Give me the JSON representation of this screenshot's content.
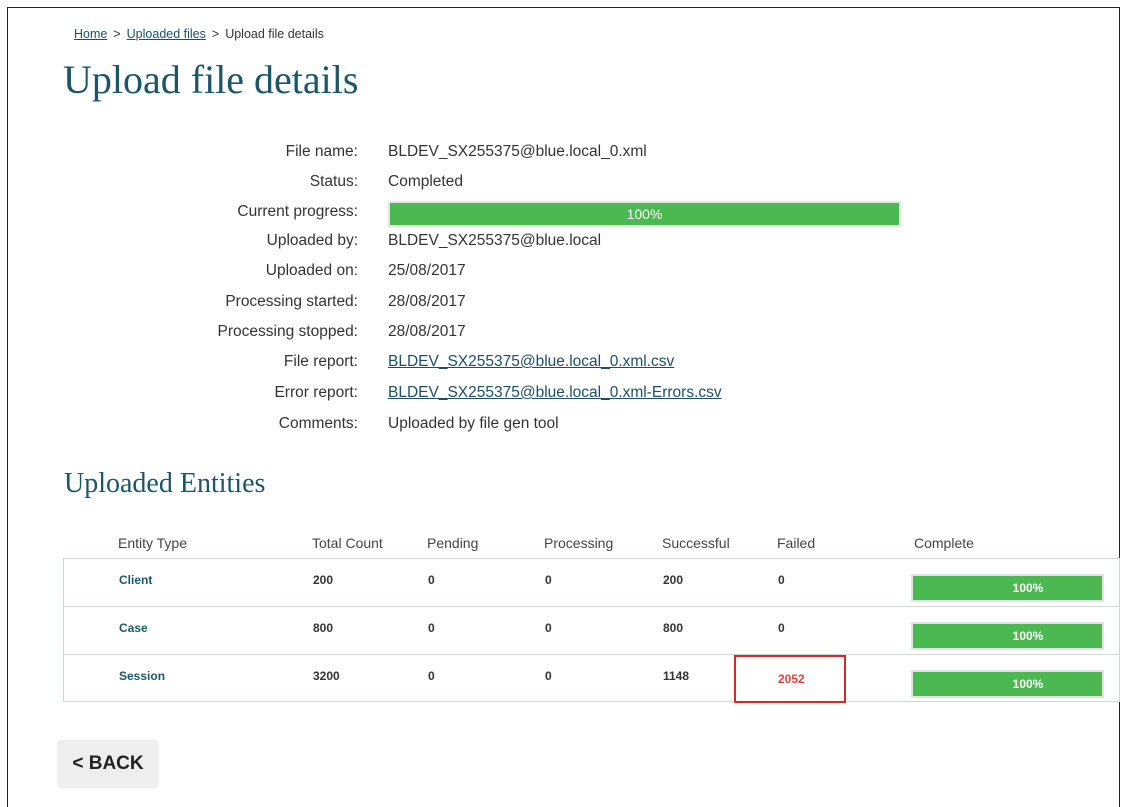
{
  "breadcrumb": {
    "home": "Home",
    "uploaded_files": "Uploaded files",
    "current": "Upload file details",
    "separator": ">"
  },
  "page_title": "Upload file details",
  "details": {
    "file_name": {
      "label": "File name:",
      "value": "BLDEV_SX255375@blue.local_0.xml"
    },
    "status": {
      "label": "Status:",
      "value": "Completed"
    },
    "current_progress": {
      "label": "Current progress:",
      "value": "100%",
      "percent": 100
    },
    "uploaded_by": {
      "label": "Uploaded by:",
      "value": "BLDEV_SX255375@blue.local"
    },
    "uploaded_on": {
      "label": "Uploaded on:",
      "value": "25/08/2017"
    },
    "processing_started": {
      "label": "Processing started:",
      "value": "28/08/2017"
    },
    "processing_stopped": {
      "label": "Processing stopped:",
      "value": "28/08/2017"
    },
    "file_report": {
      "label": "File report:",
      "value": "BLDEV_SX255375@blue.local_0.xml.csv"
    },
    "error_report": {
      "label": "Error report:",
      "value": "BLDEV_SX255375@blue.local_0.xml-Errors.csv"
    },
    "comments": {
      "label": "Comments:",
      "value": "Uploaded by file gen tool"
    }
  },
  "entities": {
    "title": "Uploaded Entities",
    "columns": [
      "Entity Type",
      "Total Count",
      "Pending",
      "Processing",
      "Successful",
      "Failed",
      "Complete"
    ],
    "rows": [
      {
        "type": "Client",
        "total": "200",
        "pending": "0",
        "processing": "0",
        "successful": "200",
        "failed": "0",
        "complete": "100%",
        "complete_percent": 100
      },
      {
        "type": "Case",
        "total": "800",
        "pending": "0",
        "processing": "0",
        "successful": "800",
        "failed": "0",
        "complete": "100%",
        "complete_percent": 100
      },
      {
        "type": "Session",
        "total": "3200",
        "pending": "0",
        "processing": "0",
        "successful": "1148",
        "failed": "2052",
        "complete": "100%",
        "complete_percent": 100
      }
    ]
  },
  "back_button": "< BACK",
  "colors": {
    "title": "#1d5668",
    "link": "#1f4e63",
    "progress": "#4cb852",
    "failed_highlight": "#e0413e",
    "highlight_box": "#d42a2a"
  }
}
